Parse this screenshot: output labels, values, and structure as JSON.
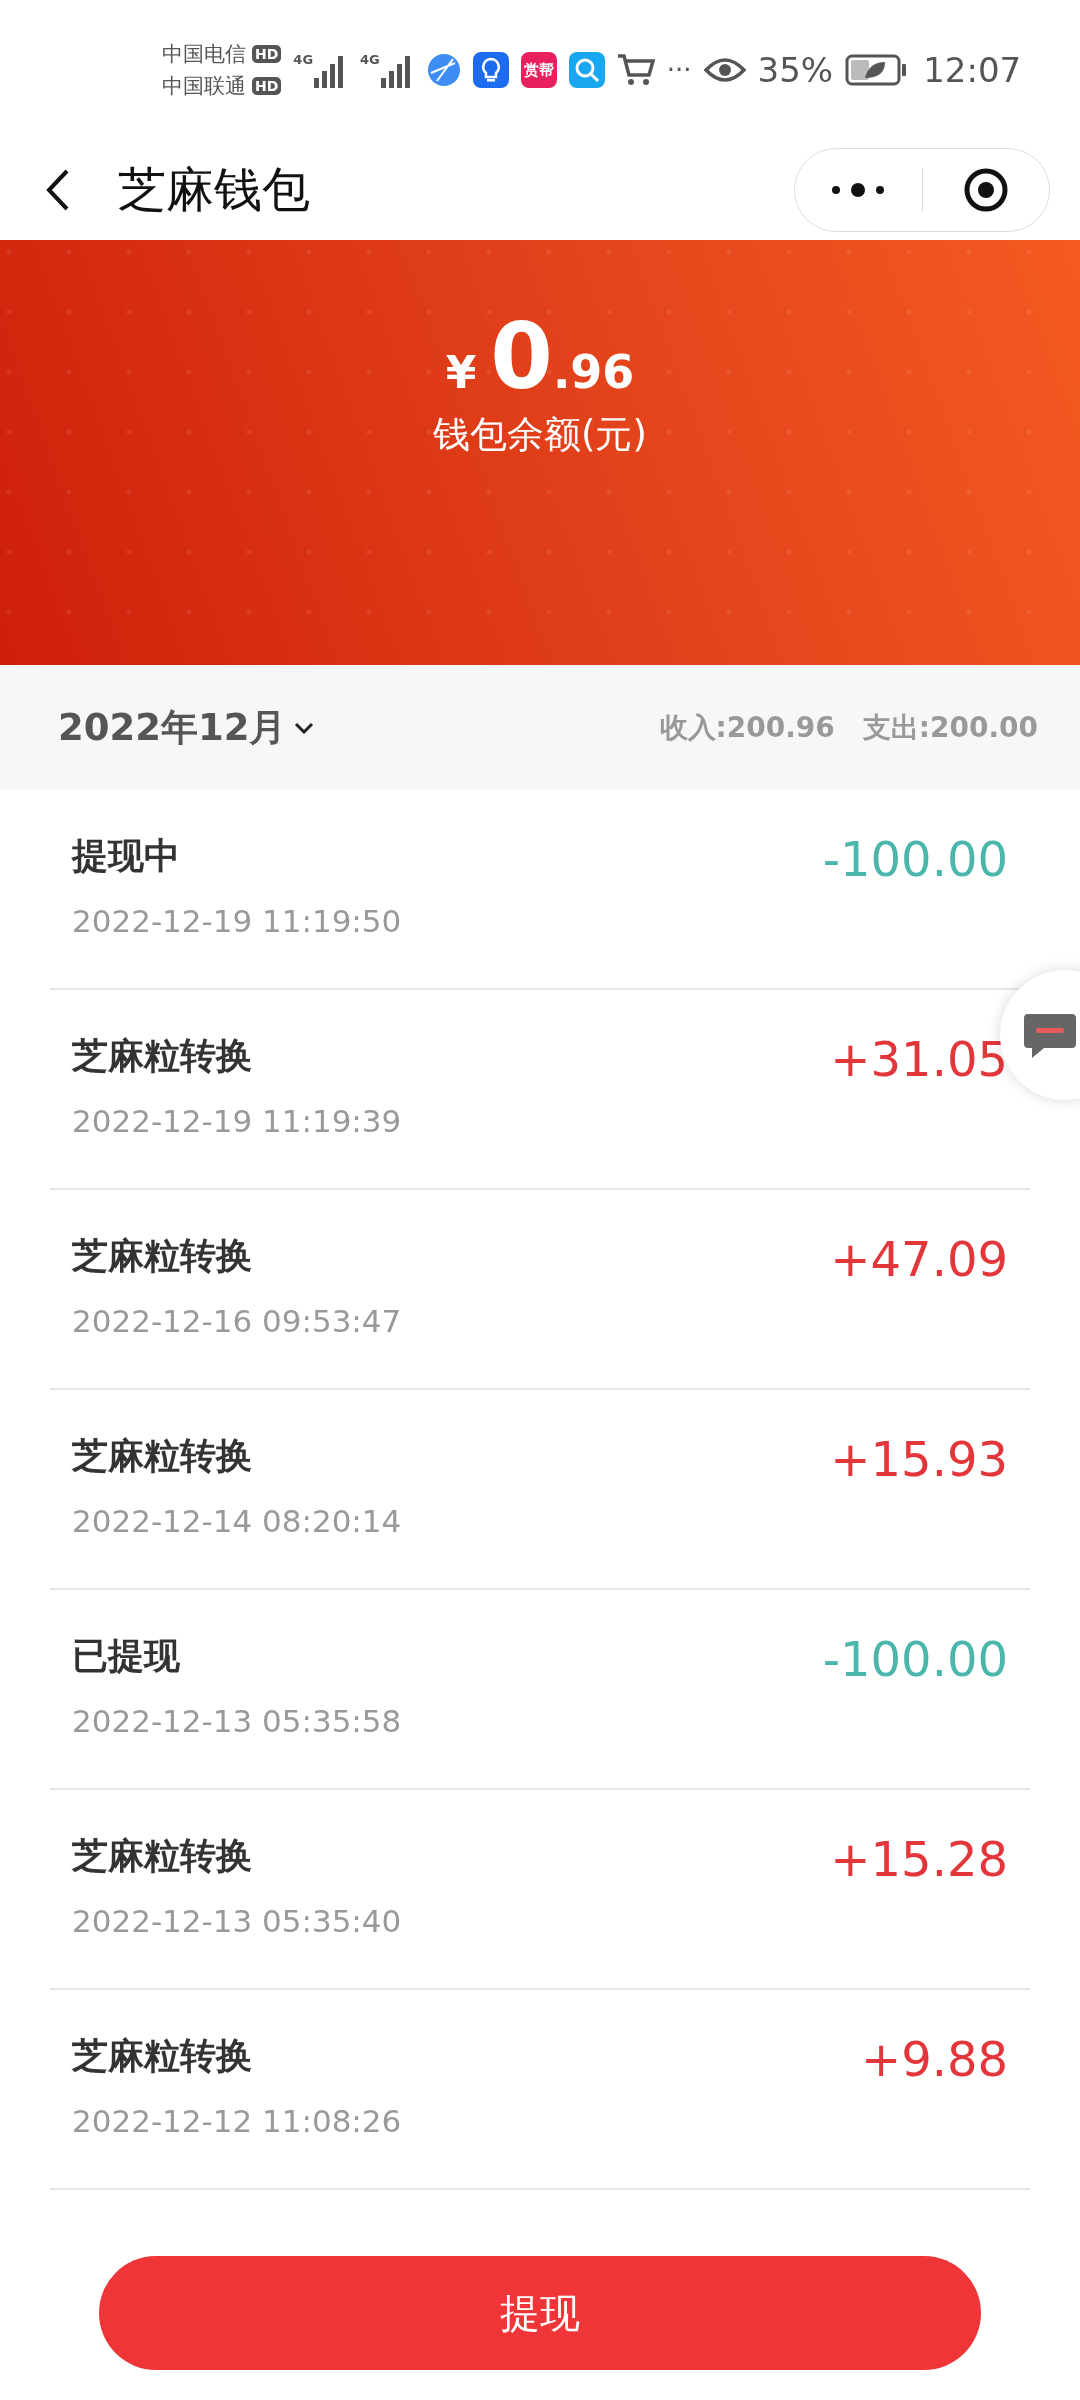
{
  "status_bar": {
    "carriers": [
      {
        "name": "中国电信",
        "badge": "HD"
      },
      {
        "name": "中国联通",
        "badge": "HD"
      }
    ],
    "networks": [
      "4G",
      "4G"
    ],
    "app_icon_label": "赏帮",
    "overflow": "···",
    "battery_text": "35%",
    "time": "12:07"
  },
  "nav": {
    "title": "芝麻钱包"
  },
  "balance": {
    "currency": "¥",
    "integer": "0",
    "decimal": ".96",
    "label": "钱包余额(元)"
  },
  "filter": {
    "month": "2022年12月",
    "income": "收入:200.96",
    "expense": "支出:200.00"
  },
  "transactions": [
    {
      "title": "提现中",
      "time": "2022-12-19 11:19:50",
      "amount": "-100.00",
      "kind": "expense"
    },
    {
      "title": "芝麻粒转换",
      "time": "2022-12-19 11:19:39",
      "amount": "+31.05",
      "kind": "income"
    },
    {
      "title": "芝麻粒转换",
      "time": "2022-12-16 09:53:47",
      "amount": "+47.09",
      "kind": "income"
    },
    {
      "title": "芝麻粒转换",
      "time": "2022-12-14 08:20:14",
      "amount": "+15.93",
      "kind": "income"
    },
    {
      "title": "已提现",
      "time": "2022-12-13 05:35:58",
      "amount": "-100.00",
      "kind": "expense"
    },
    {
      "title": "芝麻粒转换",
      "time": "2022-12-13 05:35:40",
      "amount": "+15.28",
      "kind": "income"
    },
    {
      "title": "芝麻粒转换",
      "time": "2022-12-12 11:08:26",
      "amount": "+9.88",
      "kind": "income"
    }
  ],
  "button": "提现"
}
